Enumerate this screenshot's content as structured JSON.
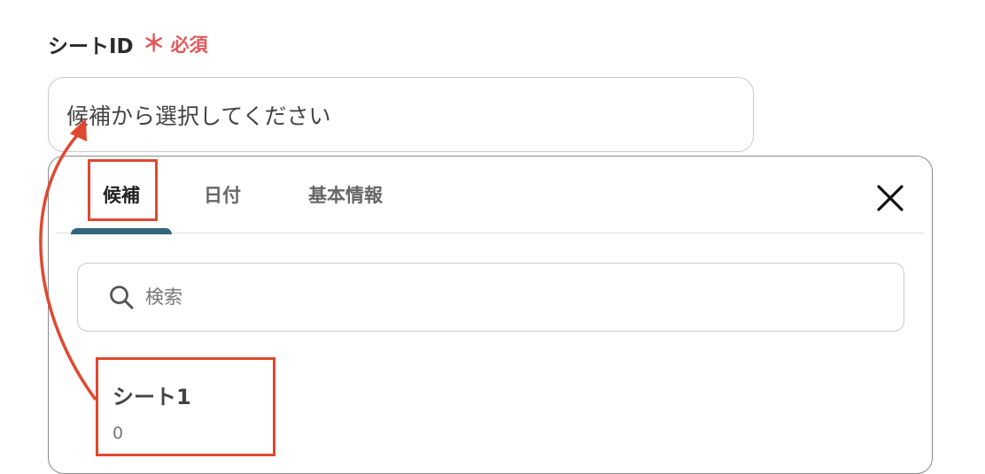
{
  "field": {
    "label": "シートID",
    "required_star": "＊",
    "required_text": "必須"
  },
  "select": {
    "placeholder": "候補から選択してください"
  },
  "dropdown": {
    "tabs": [
      {
        "label": "候補",
        "active": true
      },
      {
        "label": "日付",
        "active": false
      },
      {
        "label": "基本情報",
        "active": false
      }
    ],
    "close_icon": "close-icon",
    "search": {
      "placeholder": "検索",
      "value": "",
      "icon": "search-icon"
    },
    "options": [
      {
        "title": "シート1",
        "value": "0"
      }
    ]
  },
  "colors": {
    "accent_tab": "#33657b",
    "required": "#e3585b",
    "highlight": "#e0482f"
  }
}
